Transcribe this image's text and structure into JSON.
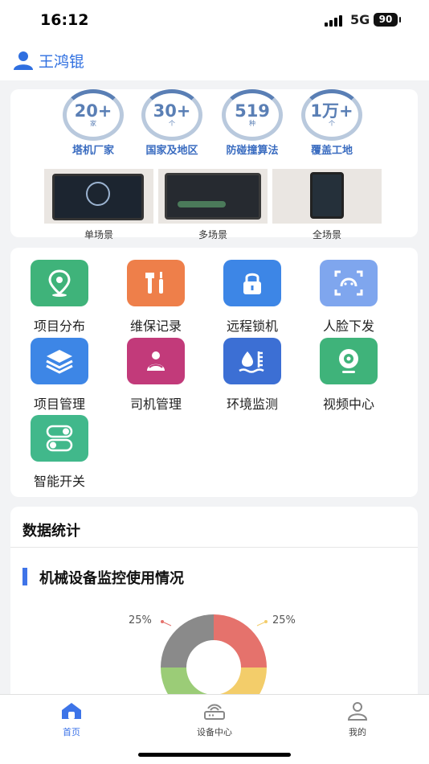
{
  "status_bar": {
    "time": "16:12",
    "network": "5G",
    "battery": "90"
  },
  "user": {
    "name": "王鸿锟",
    "icon": "user-icon"
  },
  "stats": [
    {
      "value": "20+",
      "unit": "家",
      "label": "塔机厂家"
    },
    {
      "value": "30+",
      "unit": "个",
      "label": "国家及地区"
    },
    {
      "value": "519",
      "unit": "种",
      "label": "防碰撞算法"
    },
    {
      "value": "1万+",
      "unit": "个",
      "label": "覆盖工地"
    }
  ],
  "scenes": [
    {
      "label": "单场景"
    },
    {
      "label": "多场景"
    },
    {
      "label": "全场景"
    }
  ],
  "menu": [
    {
      "label": "项目分布",
      "icon": "map-pin-icon",
      "color": "#3fb37a"
    },
    {
      "label": "维保记录",
      "icon": "wrench-icon",
      "color": "#ee7f4a"
    },
    {
      "label": "远程锁机",
      "icon": "lock-icon",
      "color": "#3d86e6"
    },
    {
      "label": "人脸下发",
      "icon": "face-scan-icon",
      "color": "#7fa6ee"
    },
    {
      "label": "项目管理",
      "icon": "layers-icon",
      "color": "#3d86e6"
    },
    {
      "label": "司机管理",
      "icon": "driver-icon",
      "color": "#c23a7a"
    },
    {
      "label": "环境监测",
      "icon": "water-level-icon",
      "color": "#3c6fd4"
    },
    {
      "label": "视频中心",
      "icon": "webcam-icon",
      "color": "#3fb37a"
    },
    {
      "label": "智能开关",
      "icon": "toggle-icon",
      "color": "#41b88b"
    }
  ],
  "data_stats": {
    "title": "数据统计",
    "section_title": "机械设备监控使用情况",
    "pct_left": "25%",
    "pct_right": "25%"
  },
  "chart_data": {
    "type": "pie",
    "values": [
      25,
      25,
      25,
      25
    ],
    "colors": [
      "#e5726c",
      "#f3cd6a",
      "#9bcc77",
      "#8a8a8a"
    ],
    "labels": [
      "25%",
      "25%"
    ]
  },
  "tabs": [
    {
      "label": "首页",
      "icon": "home-icon",
      "active": true
    },
    {
      "label": "设备中心",
      "icon": "router-icon",
      "active": false
    },
    {
      "label": "我的",
      "icon": "profile-icon",
      "active": false
    }
  ],
  "colors": {
    "accent": "#2f6fe0",
    "tab_active": "#3d74e8",
    "tab_inactive": "#888888"
  }
}
